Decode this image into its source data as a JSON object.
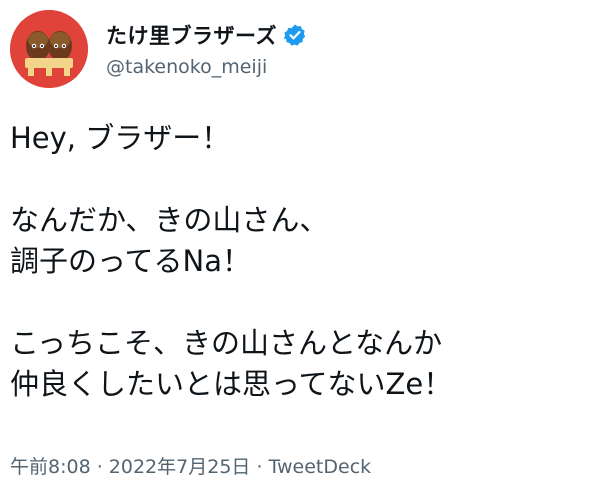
{
  "account": {
    "display_name": "たけ里ブラザーズ",
    "handle": "@takenoko_meiji",
    "verified_icon": "verified-badge-icon",
    "brand_color": "#1d9bf0",
    "avatar_color": "#e0433a"
  },
  "tweet": {
    "lines": [
      "Hey, ブラザー！",
      "なんだか、きの山さん、",
      "調子のってるNa！",
      "こっちこそ、きの山さんとなんか",
      "仲良くしたいとは思ってないZe！"
    ],
    "time": "午前8:08",
    "separator1": " · ",
    "date": "2022年7月25日",
    "separator2": " · ",
    "source": "TweetDeck"
  }
}
